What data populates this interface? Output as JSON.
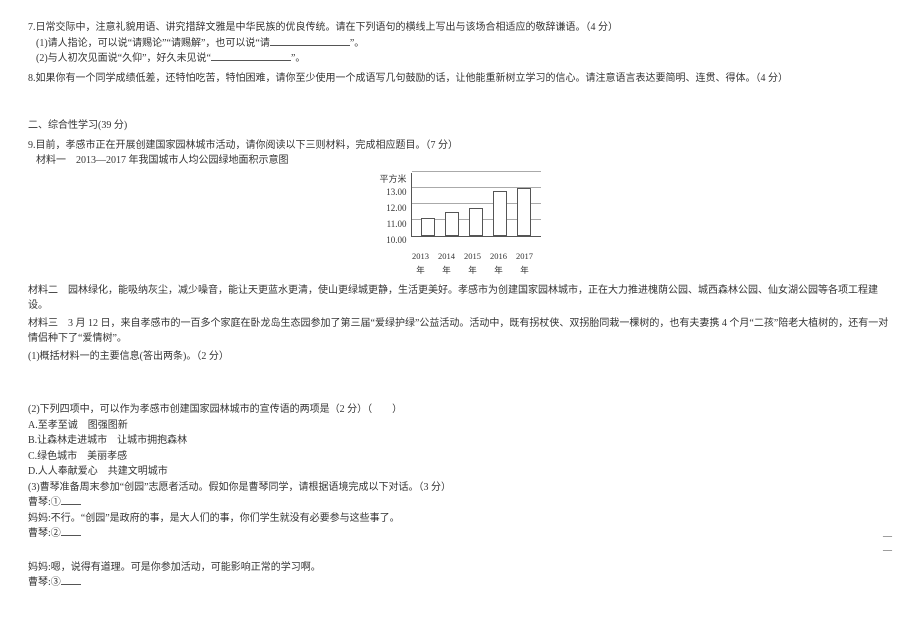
{
  "q7": {
    "stem": "7.日常交际中，注意礼貌用语、讲究措辞文雅是中华民族的优良传统。请在下列语句的横线上写出与该场合相适应的敬辞谦语。（4 分）",
    "item1_prefix": "(1)请人指论，可以说“请赐论”“请赐解”，也可以说“请",
    "item1_suffix": "”。",
    "item2_prefix": "(2)与人初次见面说“久仰”，好久未见说“",
    "item2_suffix": "”。"
  },
  "q8": {
    "stem": "8.如果你有一个同学成绩低差，还特怕吃苦，特怕困难，请你至少使用一个成语写几句鼓励的话，让他能重新树立学习的信心。请注意语言表达要简明、连贯、得体。（4 分）"
  },
  "section2": "二、综合性学习(39 分)",
  "q9": {
    "stem": "9.目前，孝感市正在开展创建国家园林城市活动，请你阅读以下三则材料，完成相应题目。（7 分）",
    "material1_label": "材料一　2013—2017 年我国城市人均公园绿地面积示意图",
    "material2": "材料二　园林绿化，能吸纳灰尘，减少噪音，能让天更蓝水更清，使山更绿城更静，生活更美好。孝感市为创建国家园林城市，正在大力推进槐荫公园、城西森林公园、仙女湖公园等各项工程建设。",
    "material3": "材料三　3 月 12 日，来自孝感市的一百多个家庭在卧龙岛生态园参加了第三届“爱绿护绿”公益活动。活动中，既有拐杖侠、双拐胎同栽一棵树的，也有夫妻携 4 个月“二孩”陪老大植树的，还有一对情侣种下了“爱情树”。",
    "sub1": "(1)概括材料一的主要信息(答出两条)。（2 分）"
  },
  "q9b": {
    "sub2": "(2)下列四项中，可以作为孝感市创建国家园林城市的宣传语的两项是（2 分）（　　）",
    "optA": "A.至孝至诚　图强图新",
    "optB": "B.让森林走进城市　让城市拥抱森林",
    "optC": "C.绿色城市　美丽孝感",
    "optD": "D.人人奉献爱心　共建文明城市",
    "sub3": "(3)曹琴准备周末参加“创园”志愿者活动。假如你是曹琴同学，请根据语境完成以下对话。（3 分）",
    "d1_label": "曹琴:①",
    "d2": "妈妈:不行。“创园”是政府的事，是大人们的事，你们学生就没有必要参与这些事了。",
    "d3_label": "曹琴:②",
    "d4": "妈妈:嗯，说得有道理。可是你参加活动，可能影响正常的学习啊。",
    "d5_label": "曹琴:③"
  },
  "chart_data": {
    "type": "bar",
    "y_unit": "平方米",
    "y_ticks": [
      "13.00",
      "12.00",
      "11.00",
      "10.00"
    ],
    "ylim": [
      10.0,
      13.5
    ],
    "categories": [
      "2013年",
      "2014年",
      "2015年",
      "2016年",
      "2017年"
    ],
    "values": [
      11.1,
      11.5,
      11.7,
      12.8,
      13.0
    ]
  },
  "trail_dash": "__"
}
